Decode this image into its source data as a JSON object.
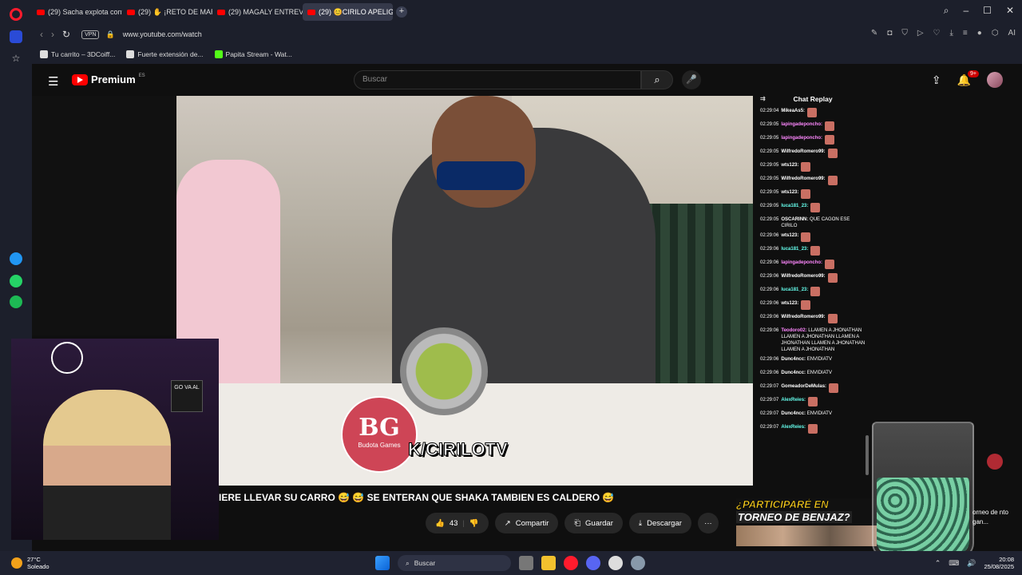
{
  "browser": {
    "tabs": [
      {
        "label": "(29) Sacha explota contra",
        "active": false
      },
      {
        "label": "(29) ✋ ¡RETO DE MARATÓ",
        "active": false
      },
      {
        "label": "(29) MAGALY ENTREVISTA",
        "active": false
      },
      {
        "label": "(29) 😊CIRILO APELIGA",
        "active": true
      }
    ],
    "url": "www.youtube.com/watch",
    "vpn_label": "VPN",
    "ai_label": "AI",
    "bookmarks": [
      "Tu carrito – 3DCoiff...",
      "Fuerte extensión de...",
      "Papita Stream - Wat..."
    ]
  },
  "youtube": {
    "brand": "Premium",
    "country": "ES",
    "search_placeholder": "Buscar",
    "notifications_badge": "9+"
  },
  "video": {
    "overlay_logo": "BG",
    "overlay_logo_sub": "Budota Games",
    "overlay_handle": "K/CIRILOTV",
    "caption": "IERE LLEVAR SU CARRO 😅 😅 SE ENTERAN QUE SHAKA TAMBIEN ES CALDERO 😅",
    "actions": {
      "likes": "43",
      "share": "Compartir",
      "save": "Guardar",
      "download": "Descargar",
      "more": "···"
    }
  },
  "chat": {
    "title": "Chat Replay",
    "messages": [
      {
        "time": "02:29:04",
        "name": "MikeaAs5:",
        "color": "white",
        "msg": ""
      },
      {
        "time": "02:29:05",
        "name": "lapingadeponcho:",
        "color": "pink",
        "msg": ""
      },
      {
        "time": "02:29:05",
        "name": "lapingadeponcho:",
        "color": "pink",
        "msg": ""
      },
      {
        "time": "02:29:05",
        "name": "WilfredoRomero99:",
        "color": "white",
        "msg": ""
      },
      {
        "time": "02:29:05",
        "name": "wts123:",
        "color": "white",
        "msg": ""
      },
      {
        "time": "02:29:05",
        "name": "WilfredoRomero99:",
        "color": "white",
        "msg": ""
      },
      {
        "time": "02:29:05",
        "name": "wts123:",
        "color": "white",
        "msg": ""
      },
      {
        "time": "02:29:05",
        "name": "luca181_23:",
        "color": "cyan",
        "msg": ""
      },
      {
        "time": "02:29:05",
        "name": "OSCARINN:",
        "color": "white",
        "msg": "QUE CAGON ESE CIRILO"
      },
      {
        "time": "02:29:06",
        "name": "wts123:",
        "color": "white",
        "msg": ""
      },
      {
        "time": "02:29:06",
        "name": "luca181_23:",
        "color": "cyan",
        "msg": ""
      },
      {
        "time": "02:29:06",
        "name": "lapingadeponcho:",
        "color": "pink",
        "msg": ""
      },
      {
        "time": "02:29:06",
        "name": "WilfredoRomero99:",
        "color": "white",
        "msg": ""
      },
      {
        "time": "02:29:06",
        "name": "luca181_23:",
        "color": "cyan",
        "msg": ""
      },
      {
        "time": "02:29:06",
        "name": "wts123:",
        "color": "white",
        "msg": ""
      },
      {
        "time": "02:29:06",
        "name": "WilfredoRomero99:",
        "color": "white",
        "msg": ""
      },
      {
        "time": "02:29:06",
        "name": "Teodoro02:",
        "color": "pink",
        "msg": "LLAMEN A JHONATHAN LLAMEN A JHONATHAN LLAMEN A JHONATHAN LLAMEN A JHONATHAN LLAMEN A JHONATHAN"
      },
      {
        "time": "02:29:06",
        "name": "Dunc4ncc:",
        "color": "white",
        "msg": "ENVIDIATV"
      },
      {
        "time": "02:29:06",
        "name": "Dunc4ncc:",
        "color": "white",
        "msg": "ENVIDIATV"
      },
      {
        "time": "02:29:07",
        "name": "GomeadorDeMulas:",
        "color": "white",
        "msg": ""
      },
      {
        "time": "02:29:07",
        "name": "AlexReies:",
        "color": "cyan",
        "msg": ""
      },
      {
        "time": "02:29:07",
        "name": "Dunc4ncc:",
        "color": "white",
        "msg": "ENVIDIATV"
      },
      {
        "time": "02:29:07",
        "name": "AlexReies:",
        "color": "cyan",
        "msg": ""
      }
    ]
  },
  "stream_overlay": {
    "cam_sign": "GO VA AL",
    "promo_line1": "¿PARTICIPARÉ EN",
    "promo_line2": "TORNEO DE BENJAZ?",
    "right_text": "orneo de nto gan..."
  },
  "taskbar": {
    "temperature": "27°C",
    "condition": "Soleado",
    "search": "Buscar",
    "time": "20:08",
    "date": "25/08/2025"
  }
}
